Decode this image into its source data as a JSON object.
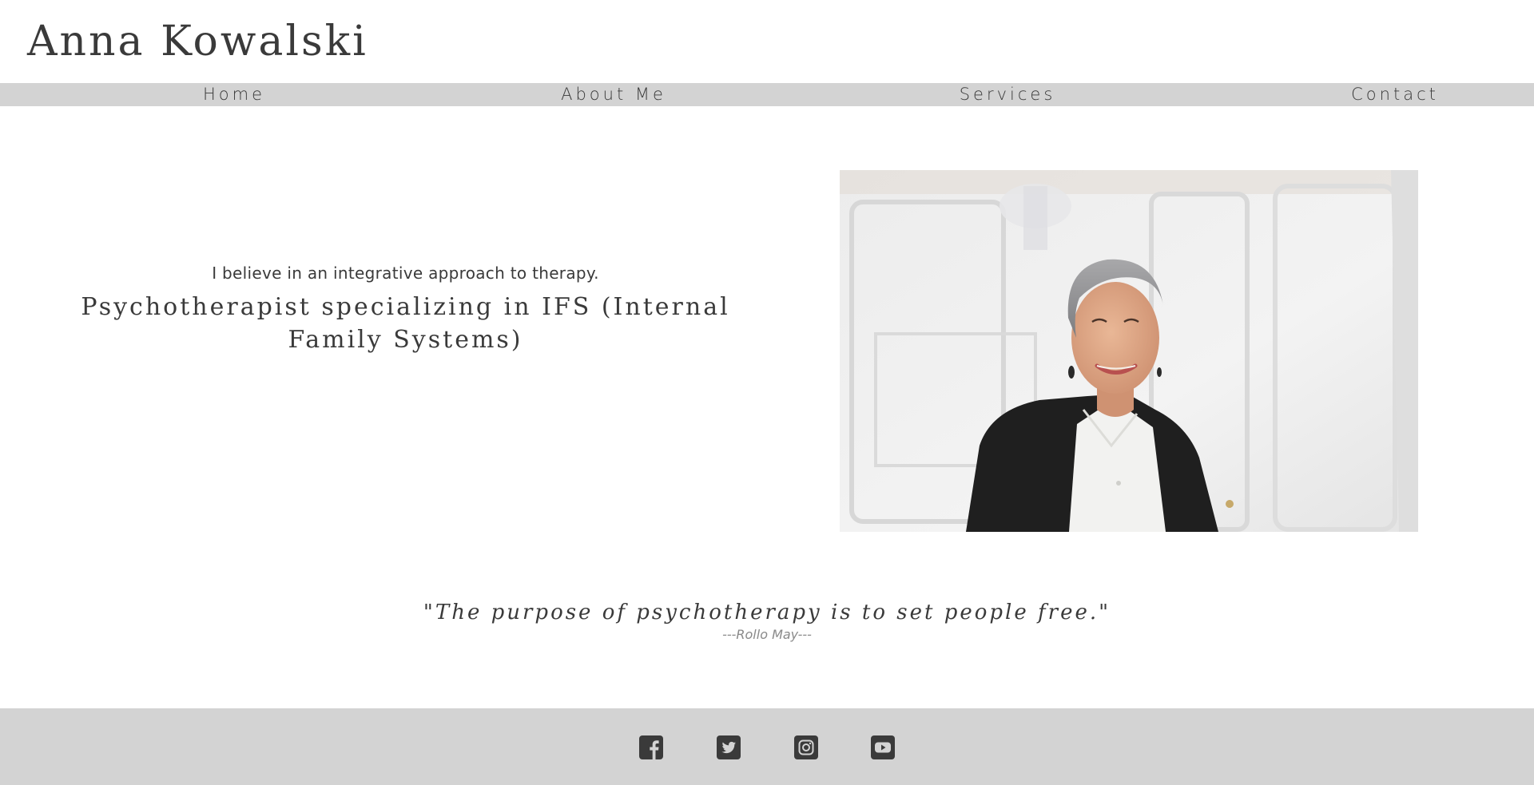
{
  "site": {
    "title": "Anna Kowalski"
  },
  "nav": {
    "items": [
      {
        "label": "Home"
      },
      {
        "label": "About Me"
      },
      {
        "label": "Services"
      },
      {
        "label": "Contact"
      }
    ]
  },
  "hero": {
    "tagline": "I believe in an integrative approach to therapy.",
    "heading": "Psychotherapist specializing in IFS (Internal Family Systems)",
    "photo_icon": "portrait-photo"
  },
  "quote": {
    "text": "\"The purpose of psychotherapy is to set people free.\"",
    "author": "---Rollo May---"
  },
  "footer": {
    "social": [
      {
        "icon": "facebook-icon"
      },
      {
        "icon": "twitter-icon"
      },
      {
        "icon": "instagram-icon"
      },
      {
        "icon": "youtube-icon"
      }
    ]
  },
  "colors": {
    "text": "#3a3a3a",
    "bar_background": "#d3d3d3",
    "page_background": "#ffffff",
    "muted_text": "#8a8a8a"
  }
}
